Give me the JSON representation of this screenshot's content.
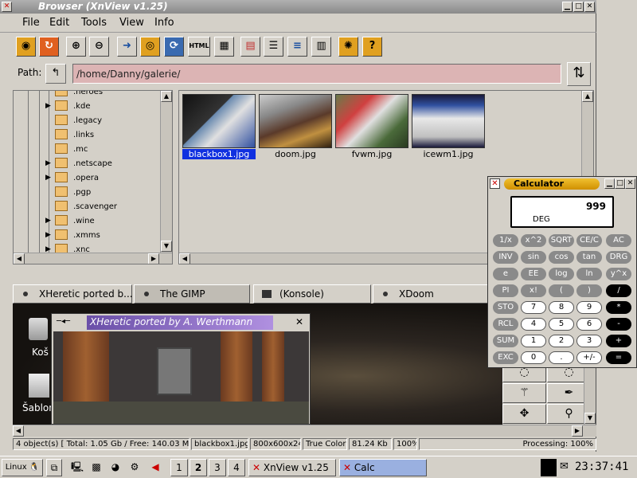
{
  "window": {
    "title": "Browser (XnView v1.25)"
  },
  "menu": {
    "items": [
      "File",
      "Edit",
      "Tools",
      "View",
      "Info"
    ]
  },
  "toolbar": {
    "icons": [
      "eye-icon",
      "refresh-icon",
      "zoom-in-icon",
      "zoom-out-icon",
      "open-icon",
      "camera-icon",
      "cycle-icon",
      "html-icon",
      "grid-icon",
      "thumbs-icon",
      "list-icon",
      "lines-icon",
      "columns-icon",
      "settings-icon",
      "help-icon"
    ],
    "html_label": "HTML"
  },
  "path": {
    "label": "Path:",
    "value": "/home/Danny/galerie/"
  },
  "tree": {
    "items": [
      {
        "label": ".heroes",
        "expand": false
      },
      {
        "label": ".kde",
        "expand": true
      },
      {
        "label": ".legacy",
        "expand": false
      },
      {
        "label": ".links",
        "expand": false
      },
      {
        "label": ".mc",
        "expand": false
      },
      {
        "label": ".netscape",
        "expand": true
      },
      {
        "label": ".opera",
        "expand": true
      },
      {
        "label": ".pgp",
        "expand": false
      },
      {
        "label": ".scavenger",
        "expand": false
      },
      {
        "label": ".wine",
        "expand": true
      },
      {
        "label": ".xmms",
        "expand": true
      },
      {
        "label": ".xnc",
        "expand": true
      }
    ]
  },
  "thumbs": [
    {
      "name": "blackbox1.jpg",
      "selected": true
    },
    {
      "name": "doom.jpg",
      "selected": false
    },
    {
      "name": "fvwm.jpg",
      "selected": false
    },
    {
      "name": "icewm1.jpg",
      "selected": false
    }
  ],
  "tabs": [
    {
      "label": "XHeretic ported b..."
    },
    {
      "label": "The GIMP"
    },
    {
      "label": "(Konsole)"
    },
    {
      "label": "XDoom"
    }
  ],
  "desktop": {
    "icons": [
      {
        "label": "Koš"
      },
      {
        "label": "Šablon"
      }
    ]
  },
  "xheretic": {
    "title": "XHeretic ported by A. Werthmann"
  },
  "calc": {
    "title": "Calculator",
    "display": "999",
    "mode": "DEG",
    "rows": [
      [
        "1/x",
        "x^2",
        "SQRT",
        "CE/C",
        "AC"
      ],
      [
        "INV",
        "sin",
        "cos",
        "tan",
        "DRG"
      ],
      [
        "e",
        "EE",
        "log",
        "ln",
        "y^x"
      ],
      [
        "PI",
        "x!",
        "(",
        ")",
        "/"
      ],
      [
        "STO",
        "7",
        "8",
        "9",
        "*"
      ],
      [
        "RCL",
        "4",
        "5",
        "6",
        "-"
      ],
      [
        "SUM",
        "1",
        "2",
        "3",
        "+"
      ],
      [
        "EXC",
        "0",
        ".",
        "+/-",
        "="
      ]
    ]
  },
  "status": {
    "objects": "4 object(s) [ Total: 1.05 Gb / Free: 140.03 Mb ]",
    "file": "blackbox1.jpg",
    "dims": "800x600x24",
    "colors": "True Colors",
    "size": "81.24 Kb",
    "zoom": "100%",
    "processing": "Processing: 100%"
  },
  "taskbar": {
    "start": "Linux",
    "desktops": [
      "1",
      "2",
      "3",
      "4"
    ],
    "tasks": [
      "XnView v1.25",
      "Calc"
    ],
    "clock": "23:37:41"
  }
}
